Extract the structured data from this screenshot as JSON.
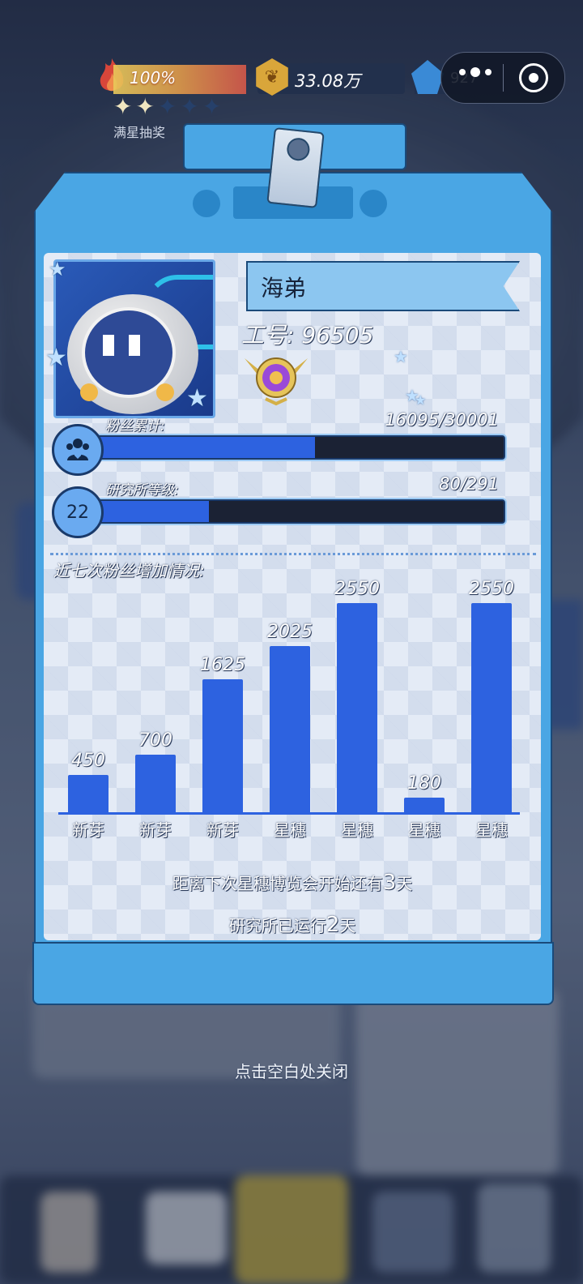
{
  "hud": {
    "heat_percent": "100%",
    "heat_stars_total": 5,
    "heat_stars_lit": 2,
    "full_star_label": "满星抽奖",
    "coins": "33.08万",
    "gems": "927",
    "icons": [
      "fire-icon",
      "coin-icon",
      "gem-icon",
      "more-icon",
      "close-target-icon"
    ]
  },
  "card": {
    "name": "海弟",
    "job_number": "工号: 96505",
    "fans": {
      "label": "粉丝累计:",
      "value": "16095/30001",
      "current": 16095,
      "max": 30001
    },
    "level": {
      "badge": "22",
      "label": "研究所等级:",
      "value": "80/291",
      "current": 80,
      "max": 291
    },
    "chart_title": "近七次粉丝增加情况:",
    "countdown": [
      "距离下次星穗博览会开始还有",
      "3",
      "天"
    ],
    "runtime": [
      "研究所已运行",
      "2",
      "天"
    ]
  },
  "chart_data": {
    "type": "bar",
    "title": "近七次粉丝增加情况:",
    "categories": [
      "新芽",
      "新芽",
      "新芽",
      "星穗",
      "星穗",
      "星穗",
      "星穗"
    ],
    "values": [
      450,
      700,
      1625,
      2025,
      2550,
      180,
      2550
    ],
    "ylim": [
      0,
      2550
    ],
    "colors": {
      "bar": "#2d62e0"
    }
  },
  "close_hint": "点击空白处关闭",
  "colors": {
    "accent": "#4aa6e4",
    "bar": "#2d62e0",
    "track": "#1b2234"
  }
}
